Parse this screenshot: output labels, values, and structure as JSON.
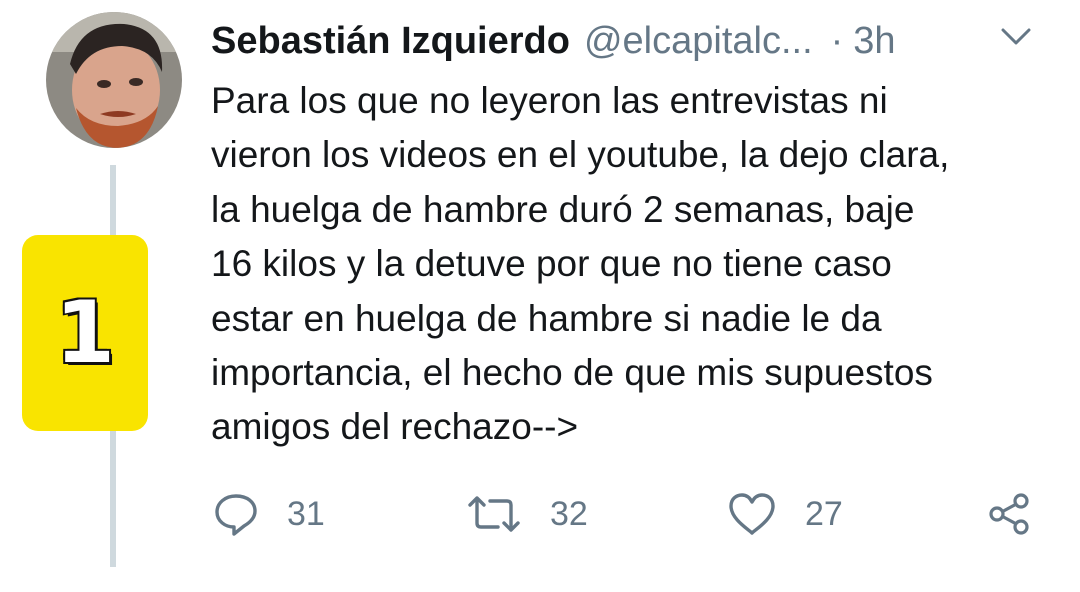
{
  "tweet": {
    "author": {
      "name": "Sebastián Izquierdo",
      "handle": "@elcapitalc...",
      "avatar_icon": "user-avatar-photo"
    },
    "separator": "·",
    "time": "3h",
    "menu_icon": "chevron-down-icon",
    "text": "Para los que no leyeron las entrevistas ni\nvieron los videos en el youtube, la dejo clara,\nla huelga de hambre duró 2 semanas, baje\n16 kilos y la detuve por que no tiene caso\nestar en huelga de hambre si nadie le da\nimportancia, el hecho de que mis supuestos\namigos del rechazo-->",
    "actions": {
      "reply": {
        "icon": "reply-icon",
        "count": "31"
      },
      "retweet": {
        "icon": "retweet-icon",
        "count": "32"
      },
      "like": {
        "icon": "heart-icon",
        "count": "27"
      },
      "share": {
        "icon": "share-icon"
      }
    }
  },
  "badge": {
    "number": "1",
    "color": "#f9e400"
  },
  "colors": {
    "text": "#14171a",
    "secondary": "#657786",
    "thread_line": "#cfd9de"
  }
}
